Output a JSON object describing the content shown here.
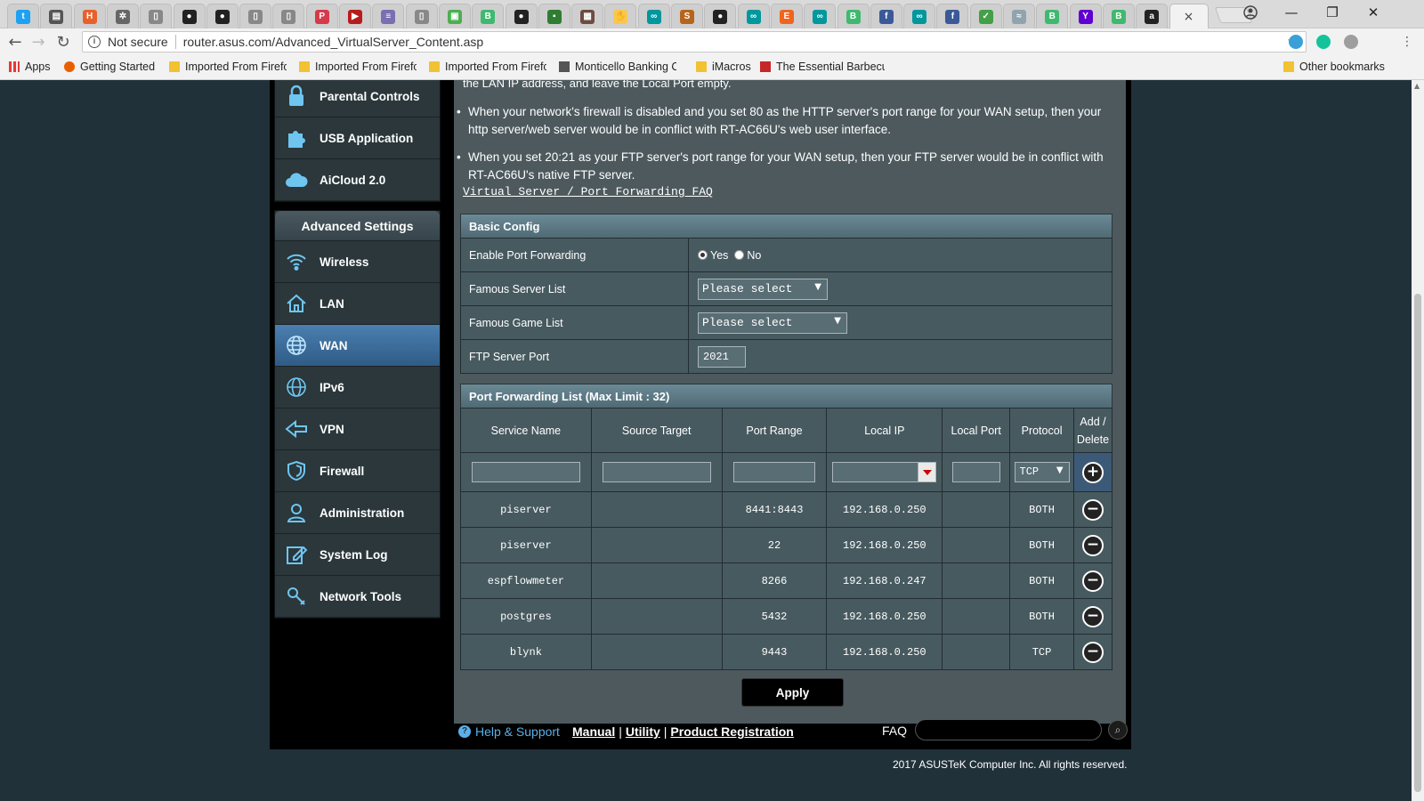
{
  "browser": {
    "address": "router.asus.com/Advanced_VirtualServer_Content.asp",
    "security_label": "Not secure",
    "tab_close": "×",
    "window_controls": [
      "—",
      "❐",
      "✕"
    ],
    "tabs": [
      {
        "icon": "twitter-icon",
        "color": "#1da1f2",
        "glyph": "t"
      },
      {
        "icon": "page-icon",
        "color": "#555555",
        "glyph": "▤"
      },
      {
        "icon": "hackaday-icon",
        "color": "#e8612c",
        "glyph": "H"
      },
      {
        "icon": "app-icon",
        "color": "#666666",
        "glyph": "✲"
      },
      {
        "icon": "document-icon",
        "color": "#888888",
        "glyph": "▯"
      },
      {
        "icon": "github-icon",
        "color": "#222222",
        "glyph": "●"
      },
      {
        "icon": "github-icon",
        "color": "#222222",
        "glyph": "●"
      },
      {
        "icon": "document-icon",
        "color": "#888888",
        "glyph": "▯"
      },
      {
        "icon": "document-icon",
        "color": "#888888",
        "glyph": "▯"
      },
      {
        "icon": "pocket-icon",
        "color": "#d43a4a",
        "glyph": "P"
      },
      {
        "icon": "video-icon",
        "color": "#b71c1c",
        "glyph": "▶"
      },
      {
        "icon": "stripes-icon",
        "color": "#7a6fb0",
        "glyph": "≡"
      },
      {
        "icon": "document-icon",
        "color": "#888888",
        "glyph": "▯"
      },
      {
        "icon": "image-icon",
        "color": "#4caf50",
        "glyph": "▣"
      },
      {
        "icon": "bootstrap-icon",
        "color": "#3fb96f",
        "glyph": "B"
      },
      {
        "icon": "github-icon",
        "color": "#222222",
        "glyph": "●"
      },
      {
        "icon": "chip-icon",
        "color": "#2e7d32",
        "glyph": "▪"
      },
      {
        "icon": "bag-icon",
        "color": "#6d4c41",
        "glyph": "▦"
      },
      {
        "icon": "hand-icon",
        "color": "#f9c74f",
        "glyph": "✋"
      },
      {
        "icon": "arduino-icon",
        "color": "#00979d",
        "glyph": "∞"
      },
      {
        "icon": "stackexchange-icon",
        "color": "#b5651d",
        "glyph": "S"
      },
      {
        "icon": "github-icon",
        "color": "#222222",
        "glyph": "●"
      },
      {
        "icon": "arduino-icon",
        "color": "#00979d",
        "glyph": "∞"
      },
      {
        "icon": "etsy-icon",
        "color": "#f1641e",
        "glyph": "E"
      },
      {
        "icon": "arduino-icon",
        "color": "#00979d",
        "glyph": "∞"
      },
      {
        "icon": "bootstrap-icon",
        "color": "#3fb96f",
        "glyph": "B"
      },
      {
        "icon": "facebook-icon",
        "color": "#3b5998",
        "glyph": "f"
      },
      {
        "icon": "arduino-icon",
        "color": "#00979d",
        "glyph": "∞"
      },
      {
        "icon": "facebook-icon",
        "color": "#3b5998",
        "glyph": "f"
      },
      {
        "icon": "leaf-icon",
        "color": "#43a047",
        "glyph": "✓"
      },
      {
        "icon": "wifi-icon",
        "color": "#90a4ae",
        "glyph": "≈"
      },
      {
        "icon": "bootstrap-icon",
        "color": "#3fb96f",
        "glyph": "B"
      },
      {
        "icon": "yahoo-icon",
        "color": "#6001d2",
        "glyph": "Y"
      },
      {
        "icon": "bootstrap-icon",
        "color": "#3fb96f",
        "glyph": "B"
      },
      {
        "icon": "amazon-icon",
        "color": "#222222",
        "glyph": "a"
      }
    ],
    "extensions": [
      {
        "icon": "gear-ext-icon",
        "color": "#3aa0d8"
      },
      {
        "icon": "grammarly-icon",
        "color": "#15c39a"
      },
      {
        "icon": "extension-icon",
        "color": "#9e9e9e"
      }
    ],
    "bookmarks": [
      {
        "label": "Apps",
        "icon": "apps-grid-icon"
      },
      {
        "label": "Getting Started",
        "icon": "firefox-icon"
      },
      {
        "label": "Imported From Firefc",
        "icon": "folder-icon"
      },
      {
        "label": "Imported From Firefc",
        "icon": "folder-icon"
      },
      {
        "label": "Imported From Firefc",
        "icon": "folder-icon"
      },
      {
        "label": "Monticello Banking C",
        "icon": "bank-icon"
      },
      {
        "label": "iMacros",
        "icon": "folder-icon"
      },
      {
        "label": "The Essential Barbecu",
        "icon": "e-logo-icon"
      }
    ],
    "other_bookmarks": "Other bookmarks"
  },
  "sidebar": {
    "top_items": [
      {
        "label": "Parental Controls",
        "icon": "lock-icon"
      },
      {
        "label": "USB Application",
        "icon": "puzzle-icon"
      },
      {
        "label": "AiCloud 2.0",
        "icon": "cloud-icon"
      }
    ],
    "advanced_header": "Advanced Settings",
    "advanced_items": [
      {
        "label": "Wireless",
        "icon": "wifi-icon",
        "selected": false
      },
      {
        "label": "LAN",
        "icon": "home-icon",
        "selected": false
      },
      {
        "label": "WAN",
        "icon": "globe-icon",
        "selected": true
      },
      {
        "label": "IPv6",
        "icon": "ipv6-icon",
        "selected": false
      },
      {
        "label": "VPN",
        "icon": "vpn-icon",
        "selected": false
      },
      {
        "label": "Firewall",
        "icon": "shield-icon",
        "selected": false
      },
      {
        "label": "Administration",
        "icon": "user-icon",
        "selected": false
      },
      {
        "label": "System Log",
        "icon": "edit-icon",
        "selected": false
      },
      {
        "label": "Network Tools",
        "icon": "tools-icon",
        "selected": false
      }
    ]
  },
  "content": {
    "top_note": "the LAN IP address, and leave the Local Port empty.",
    "bullets": [
      "When your network's firewall is disabled and you set 80 as the HTTP server's port range for your WAN setup, then your http server/web server would be in conflict with RT-AC66U's web user interface.",
      "When you set 20:21 as your FTP server's port range for your WAN setup, then your FTP server would be in conflict with RT-AC66U's native FTP server."
    ],
    "faq_link": "Virtual Server / Port Forwarding FAQ",
    "basic_config": {
      "title": "Basic Config",
      "enable_label": "Enable Port Forwarding",
      "yes": "Yes",
      "no": "No",
      "enabled": "yes",
      "famous_server_label": "Famous Server List",
      "famous_server_value": "Please select",
      "famous_game_label": "Famous Game List",
      "famous_game_value": "Please select",
      "ftp_label": "FTP Server Port",
      "ftp_value": "2021"
    },
    "port_forwarding": {
      "title": "Port Forwarding List (Max Limit : 32)",
      "headers": [
        "Service Name",
        "Source Target",
        "Port Range",
        "Local IP",
        "Local Port",
        "Protocol",
        "Add / Delete"
      ],
      "new_protocol": "TCP",
      "add_glyph": "+",
      "delete_glyph": "−",
      "rows": [
        {
          "service": "piserver",
          "source": "",
          "port_range": "8441:8443",
          "local_ip": "192.168.0.250",
          "local_port": "",
          "protocol": "BOTH"
        },
        {
          "service": "piserver",
          "source": "",
          "port_range": "22",
          "local_ip": "192.168.0.250",
          "local_port": "",
          "protocol": "BOTH"
        },
        {
          "service": "espflowmeter",
          "source": "",
          "port_range": "8266",
          "local_ip": "192.168.0.247",
          "local_port": "",
          "protocol": "BOTH"
        },
        {
          "service": "postgres",
          "source": "",
          "port_range": "5432",
          "local_ip": "192.168.0.250",
          "local_port": "",
          "protocol": "BOTH"
        },
        {
          "service": "blynk",
          "source": "",
          "port_range": "9443",
          "local_ip": "192.168.0.250",
          "local_port": "",
          "protocol": "TCP"
        }
      ]
    },
    "apply_label": "Apply"
  },
  "footer": {
    "help_label": "Help & Support",
    "manual": "Manual",
    "utility": "Utility",
    "product_registration": "Product Registration",
    "faq_label": "FAQ",
    "copyright": "2017 ASUSTeK Computer Inc. All rights reserved."
  }
}
